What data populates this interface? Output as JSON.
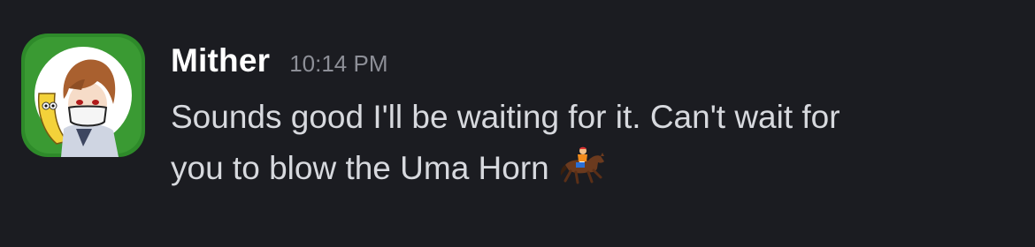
{
  "message": {
    "username": "Mither",
    "timestamp": "10:14 PM",
    "text_line_1": "Sounds good I'll be waiting for it. Can't wait for",
    "text_line_2": "you to blow the Uma Horn",
    "emoji": "horse-racing-emoji"
  },
  "avatar": {
    "frame_color": "#2f8a2a",
    "background_color": "#ffffff"
  }
}
